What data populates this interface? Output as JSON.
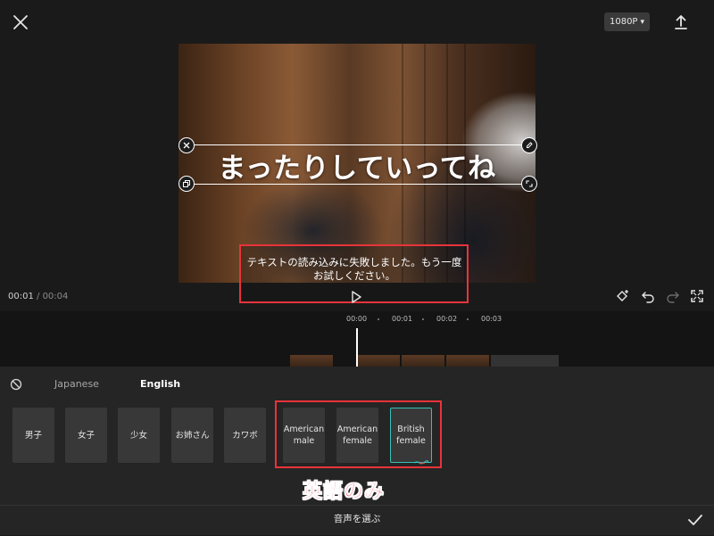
{
  "top_bar": {
    "resolution": "1080P",
    "resolution_caret": "▾"
  },
  "preview": {
    "overlay_text": "まったりしていってね"
  },
  "error": {
    "line1": "テキストの読み込みに失敗しました。もう一度",
    "line2": "お試しください。"
  },
  "playback": {
    "current_time": "00:01",
    "separator": " / ",
    "total_time": "00:04"
  },
  "timeline": {
    "ticks": [
      "00:00",
      "00:01",
      "00:02",
      "00:03"
    ]
  },
  "voice_panel": {
    "tabs": [
      {
        "label": "Japanese",
        "active": false
      },
      {
        "label": "English",
        "active": true
      }
    ],
    "voices": [
      {
        "label": "男子"
      },
      {
        "label": "女子"
      },
      {
        "label": "少女"
      },
      {
        "label": "お姉さん"
      },
      {
        "label": "カワボ"
      },
      {
        "label": "American\nmale"
      },
      {
        "label": "American\nfemale"
      },
      {
        "label": "British\nfemale",
        "selected": true
      }
    ],
    "annotation": "英語のみ",
    "bottom_label": "音声を選ぶ"
  },
  "colors": {
    "highlight_red": "#e8333a",
    "selection_teal": "#35c2b6",
    "annotation_pink": "#f0364f"
  }
}
